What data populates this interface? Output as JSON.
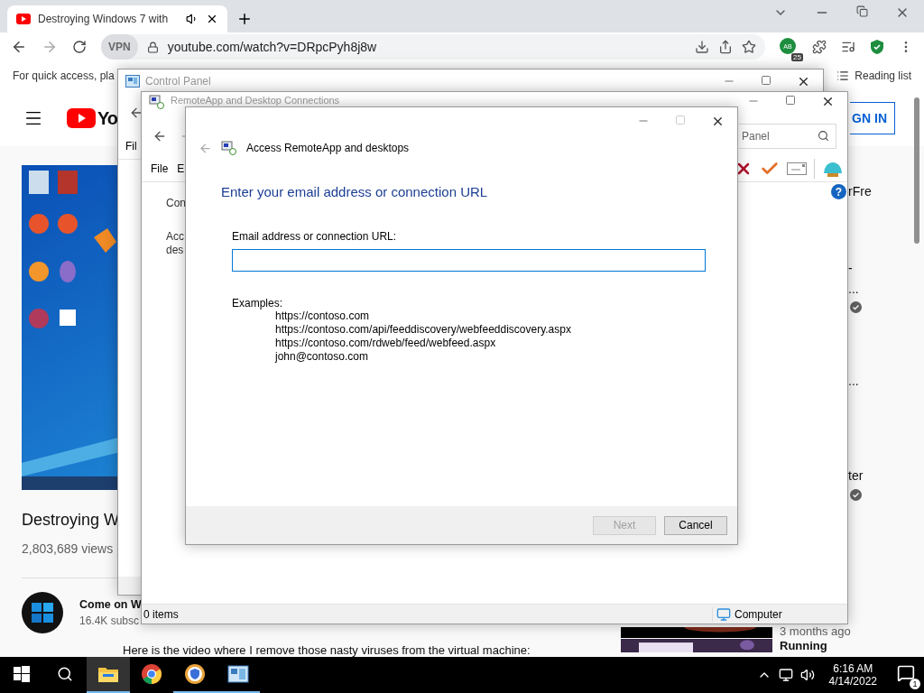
{
  "browser": {
    "tab": {
      "title": "Destroying Windows 7 with"
    },
    "toolbar": {
      "vpn": "VPN",
      "url": "youtube.com/watch?v=DRpcPyh8j8w",
      "extension_label": "AB",
      "extension_badge": "25"
    },
    "bookmarks_bar": {
      "hint": "For quick access, pla",
      "reading_list": "Reading list"
    }
  },
  "youtube": {
    "logo_text": "Yo",
    "sign_in": "GN IN",
    "video": {
      "title": "Destroying W",
      "views": "2,803,689 views"
    },
    "channel": {
      "name": "Come on W",
      "subscribers": "16.4K subsc"
    },
    "description": "Here is the video where I remove those nasty viruses from the virtual machine:",
    "related_fragments": [
      {
        "kind": "title",
        "text": "rFre"
      },
      {
        "kind": "title",
        "text": "-"
      },
      {
        "kind": "title",
        "text": "..."
      },
      {
        "kind": "verified"
      },
      {
        "kind": "title",
        "text": "..."
      },
      {
        "kind": "title",
        "text": "ter"
      },
      {
        "kind": "verified"
      }
    ],
    "related": [
      {
        "kind": "meta",
        "text": "3 months ago"
      },
      {
        "kind": "title",
        "text": "Running"
      }
    ]
  },
  "control_panel": {
    "title": "Control Panel",
    "menu": [
      "Fil"
    ]
  },
  "remoteapp_window": {
    "title": "RemoteApp and Desktop Connections",
    "search_placeholder": "Panel",
    "menu": [
      "File",
      "E"
    ],
    "links": [
      "Con",
      "Acc des"
    ],
    "status_bar": {
      "items": "0 items",
      "location": "Computer"
    }
  },
  "dialog": {
    "title": "Access RemoteApp and desktops",
    "heading": "Enter your email address or connection URL",
    "field": {
      "label": "Email address or connection URL:"
    },
    "examples_label": "Examples:",
    "examples": [
      "https://contoso.com",
      "https://contoso.com/api/feeddiscovery/webfeeddiscovery.aspx",
      "https://contoso.com/rdweb/feed/webfeed.aspx",
      "john@contoso.com"
    ],
    "buttons": [
      {
        "label": "Next",
        "disabled": true
      },
      {
        "label": "Cancel",
        "disabled": false
      }
    ]
  },
  "help": "?",
  "taskbar": {
    "apps": [
      {
        "kind": "explorer",
        "selected": true,
        "running": true
      },
      {
        "kind": "chrome",
        "selected": false,
        "running": false
      },
      {
        "kind": "browser",
        "selected": false,
        "running": true
      },
      {
        "kind": "control-panel",
        "selected": false,
        "running": true
      }
    ],
    "time": "6:16 AM",
    "date": "4/14/2022",
    "notifications": "1"
  }
}
